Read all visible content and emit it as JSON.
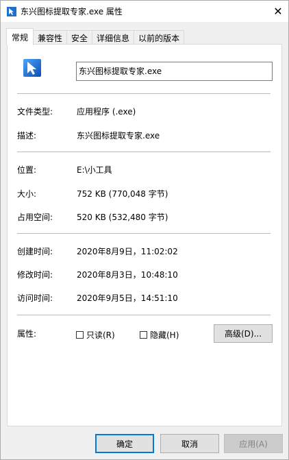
{
  "window": {
    "title": "东兴图标提取专家.exe 属性",
    "close_glyph": "✕"
  },
  "tabs": [
    {
      "label": "常规",
      "active": true
    },
    {
      "label": "兼容性"
    },
    {
      "label": "安全"
    },
    {
      "label": "详细信息"
    },
    {
      "label": "以前的版本"
    }
  ],
  "general": {
    "file_name": "东兴图标提取专家.exe",
    "file_type_label": "文件类型:",
    "file_type_value": "应用程序 (.exe)",
    "description_label": "描述:",
    "description_value": "东兴图标提取专家.exe",
    "location_label": "位置:",
    "location_value": "E:\\小工具",
    "size_label": "大小:",
    "size_value": "752 KB (770,048 字节)",
    "size_on_disk_label": "占用空间:",
    "size_on_disk_value": "520 KB (532,480 字节)",
    "created_label": "创建时间:",
    "created_value": "2020年8月9日，11:02:02",
    "modified_label": "修改时间:",
    "modified_value": "2020年8月3日，10:48:10",
    "accessed_label": "访问时间:",
    "accessed_value": "2020年9月5日，14:51:10",
    "attributes_label": "属性:",
    "readonly_label": "只读(R)",
    "readonly_checked": false,
    "hidden_label": "隐藏(H)",
    "hidden_checked": false,
    "advanced_label": "高级(D)..."
  },
  "footer": {
    "ok_label": "确定",
    "cancel_label": "取消",
    "apply_label": "应用(A)"
  },
  "colors": {
    "accent": "#0078d7",
    "icon_blue": "#1e6fd0"
  },
  "icons": {
    "title_icon": "app-cursor-icon",
    "app_icon": "app-cursor-icon"
  }
}
